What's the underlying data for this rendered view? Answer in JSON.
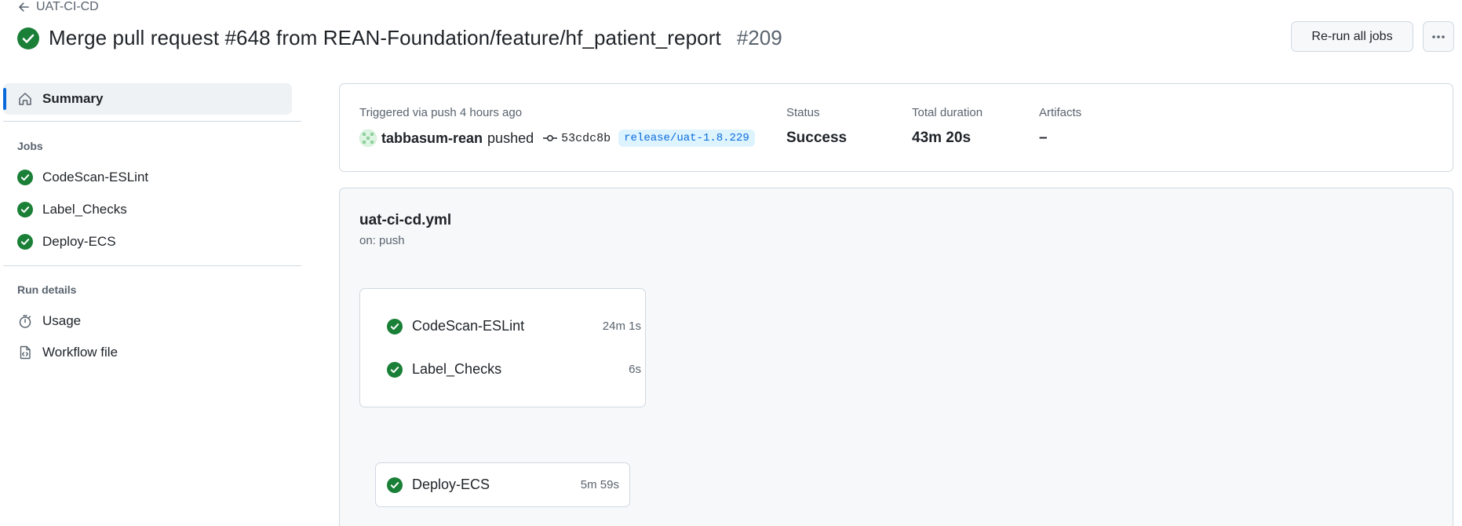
{
  "header": {
    "back_label": "UAT-CI-CD",
    "title": "Merge pull request #648 from REAN-Foundation/feature/hf_patient_report",
    "run_number": "#209",
    "rerun_label": "Re-run all jobs",
    "more_icon": "kebab-horizontal-icon"
  },
  "sidebar": {
    "summary_label": "Summary",
    "jobs_heading": "Jobs",
    "jobs": [
      {
        "label": "CodeScan-ESLint",
        "status": "success"
      },
      {
        "label": "Label_Checks",
        "status": "success"
      },
      {
        "label": "Deploy-ECS",
        "status": "success"
      }
    ],
    "run_details_heading": "Run details",
    "details": [
      {
        "label": "Usage",
        "icon": "stopwatch-icon"
      },
      {
        "label": "Workflow file",
        "icon": "file-code-icon"
      }
    ]
  },
  "summary": {
    "triggered_label": "Triggered via push 4 hours ago",
    "actor": "tabbasum-rean",
    "action": "pushed",
    "commit": "53cdc8b",
    "branch": "release/uat-1.8.229",
    "status_label": "Status",
    "status_value": "Success",
    "duration_label": "Total duration",
    "duration_value": "43m 20s",
    "artifacts_label": "Artifacts",
    "artifacts_value": "–"
  },
  "workflow": {
    "file": "uat-ci-cd.yml",
    "trigger": "on: push",
    "group_jobs": [
      {
        "label": "CodeScan-ESLint",
        "duration": "24m 1s"
      },
      {
        "label": "Label_Checks",
        "duration": "6s"
      }
    ],
    "deploy_job": {
      "label": "Deploy-ECS",
      "duration": "5m 59s"
    }
  },
  "colors": {
    "success": "#1a7f37",
    "accent": "#0969da",
    "muted": "#59636e",
    "border": "#d1d9e0"
  }
}
